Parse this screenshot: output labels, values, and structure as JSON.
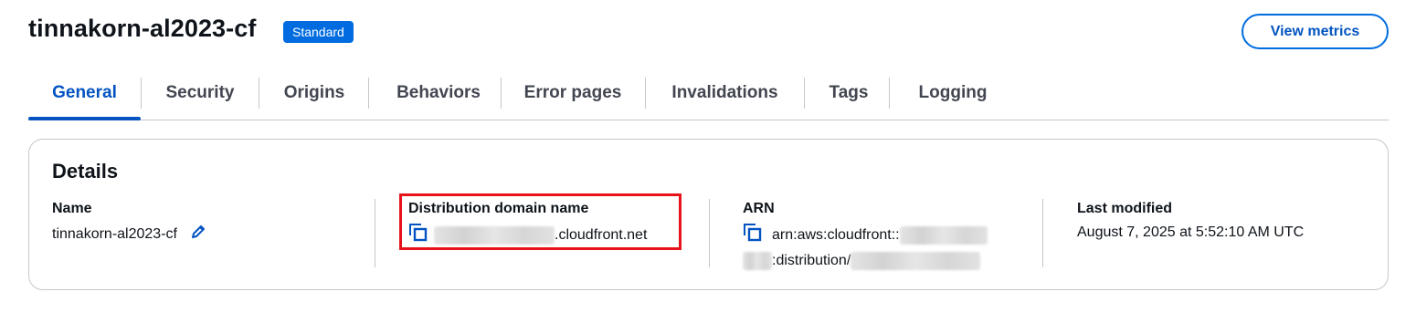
{
  "header": {
    "title": "tinnakorn-al2023-cf",
    "badge": "Standard",
    "view_metrics_label": "View metrics"
  },
  "tabs": [
    {
      "label": "General",
      "active": true
    },
    {
      "label": "Security"
    },
    {
      "label": "Origins"
    },
    {
      "label": "Behaviors"
    },
    {
      "label": "Error pages"
    },
    {
      "label": "Invalidations"
    },
    {
      "label": "Tags"
    },
    {
      "label": "Logging"
    }
  ],
  "details": {
    "title": "Details",
    "name": {
      "label": "Name",
      "value": "tinnakorn-al2023-cf"
    },
    "domain": {
      "label": "Distribution domain name",
      "suffix": ".cloudfront.net"
    },
    "arn": {
      "label": "ARN",
      "line1_prefix": "arn:aws:cloudfront::",
      "line2_middle": ":distribution/"
    },
    "last_modified": {
      "label": "Last modified",
      "value": "August 7, 2025 at 5:52:10 AM UTC"
    }
  },
  "colors": {
    "accent": "#0354c1",
    "badge": "#006ce0",
    "highlight": "#e8121b"
  },
  "icons": [
    "edit-pencil-icon",
    "copy-icon"
  ]
}
